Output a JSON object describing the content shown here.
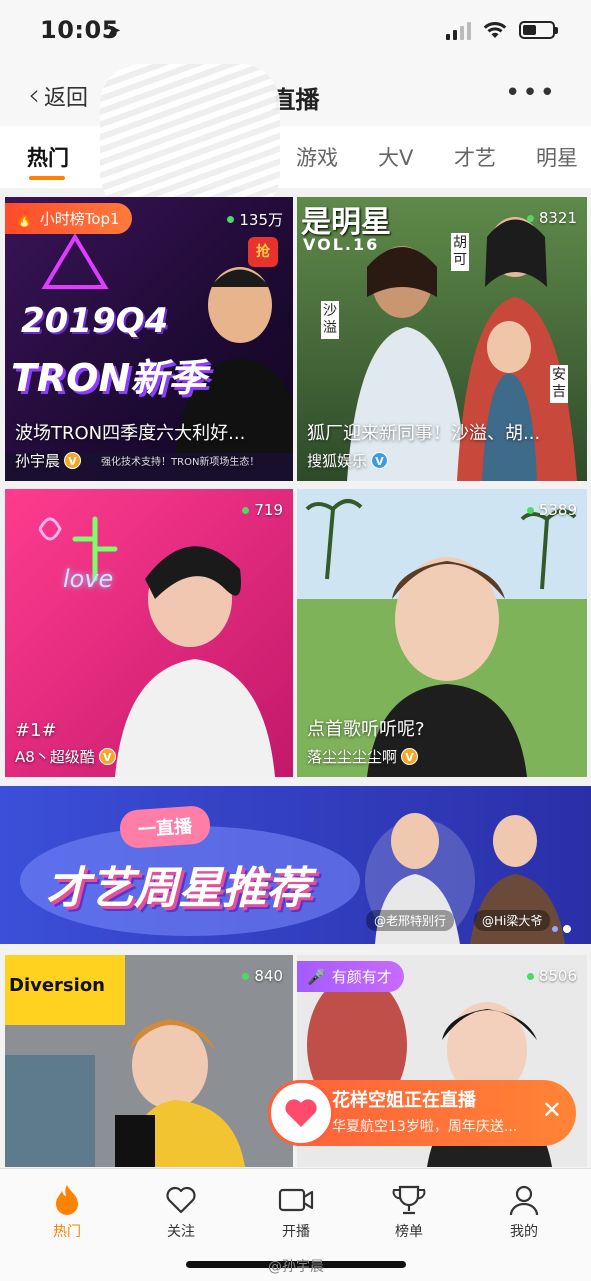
{
  "status": {
    "time": "10:05"
  },
  "nav": {
    "back_label": "返回",
    "title": "直播",
    "more": "•••"
  },
  "tabs": [
    {
      "label": "热门",
      "active": true
    },
    {
      "label": "游戏"
    },
    {
      "label": "大V"
    },
    {
      "label": "才艺"
    },
    {
      "label": "明星"
    }
  ],
  "cards": [
    {
      "tag": "小时榜Top1",
      "viewers": "135万",
      "title": "波场TRON四季度六大利好...",
      "author": "孙宇晨",
      "badge": "V",
      "art_text": [
        "2019Q4",
        "TRON新季"
      ],
      "red_packet": "抢",
      "strip": "强化技术支持！TRON新项场生态！"
    },
    {
      "viewers": "8321",
      "title": "狐厂迎来新同事！沙溢、胡...",
      "author": "搜狐娱乐",
      "badge": "V",
      "art_text": [
        "是明星",
        "VOL.16"
      ],
      "names": [
        "胡可",
        "沙溢",
        "安吉"
      ]
    },
    {
      "viewers": "719",
      "title": "#1#",
      "author": "A8丶超级酷",
      "badge": "V",
      "art_text": [
        "love"
      ]
    },
    {
      "viewers": "5389",
      "title": "点首歌听听呢?",
      "author": "落尘尘尘尘啊",
      "badge": "V"
    },
    {
      "viewers": "840",
      "art_text": [
        "Diversion"
      ]
    },
    {
      "tag": "有颜有才",
      "viewers": "8506"
    }
  ],
  "banner": {
    "badge": "一直播",
    "headline": "才艺周星推荐",
    "user1": "@老邢特别行",
    "user2": "@Hi梁大爷"
  },
  "toast": {
    "title": "花样空姐正在直播",
    "subtitle": "华夏航空13岁啦，周年庆送...",
    "close": "✕"
  },
  "bottom_tabs": [
    {
      "label": "热门",
      "icon": "flame-icon"
    },
    {
      "label": "关注",
      "icon": "heart-icon"
    },
    {
      "label": "开播",
      "icon": "camera-icon"
    },
    {
      "label": "榜单",
      "icon": "trophy-icon"
    },
    {
      "label": "我的",
      "icon": "user-icon"
    }
  ],
  "watermark": "@孙宇晨",
  "colors": {
    "accent": "#ff8200",
    "live_dot": "#4cd964",
    "vip_badge": "#f5a623"
  }
}
